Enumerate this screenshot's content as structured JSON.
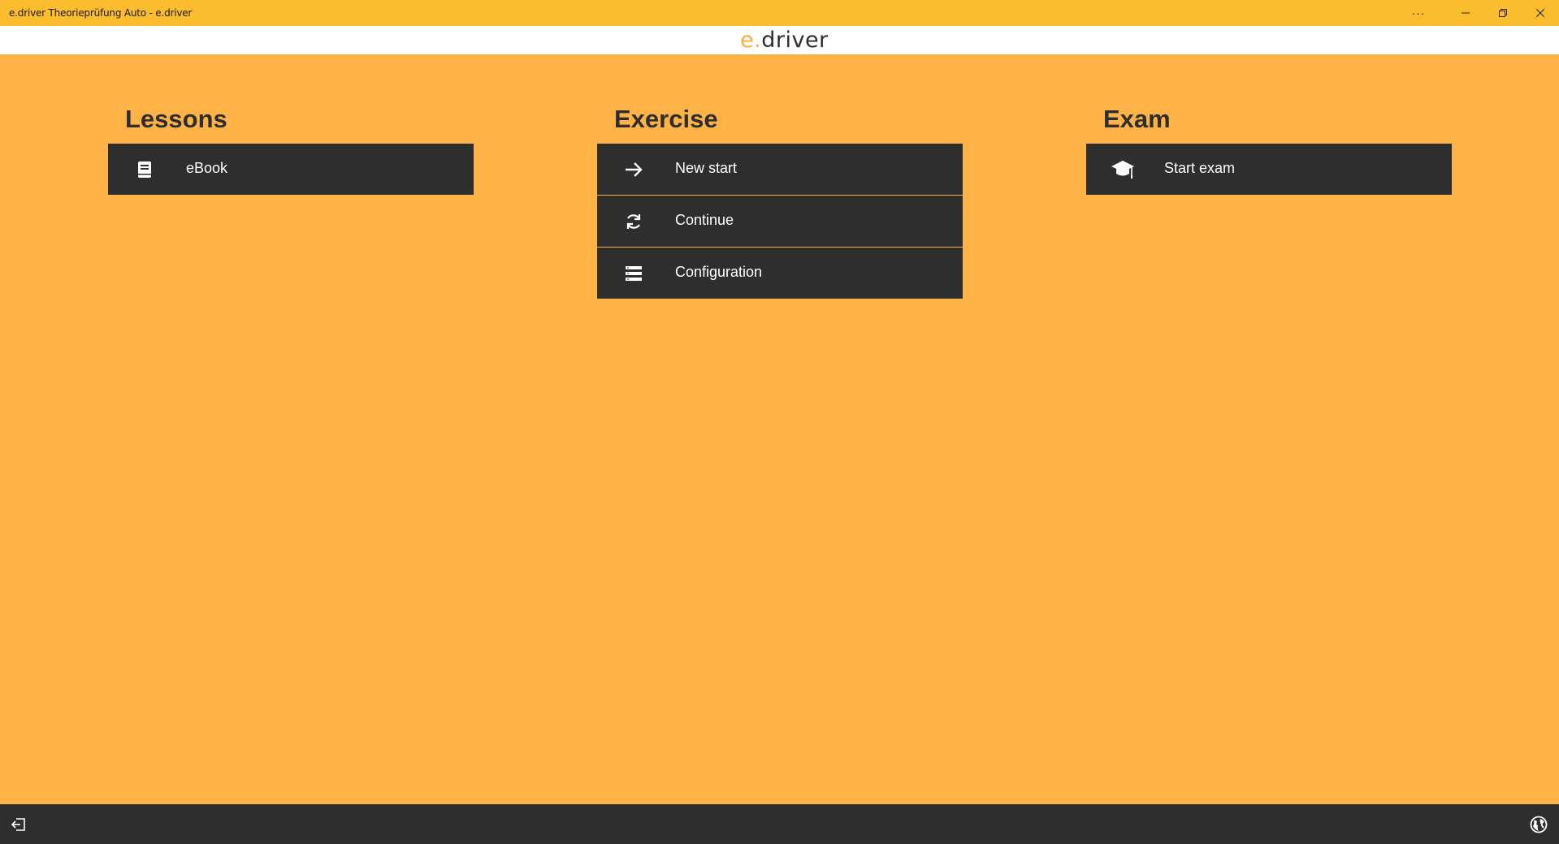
{
  "window": {
    "title": "e.driver Theorieprüfung Auto - e.driver",
    "more_glyph": "···",
    "minimize_glyph": "—",
    "maximize_glyph": "❐",
    "close_glyph": "✕"
  },
  "header": {
    "logo_e": "e",
    "logo_dot": ".",
    "logo_rest": "driver"
  },
  "lessons": {
    "title": "Lessons",
    "items": [
      {
        "label": "eBook",
        "icon": "book-icon"
      }
    ]
  },
  "exercise": {
    "title": "Exercise",
    "items": [
      {
        "label": "New start",
        "icon": "arrow-right-icon"
      },
      {
        "label": "Continue",
        "icon": "refresh-icon"
      },
      {
        "label": "Configuration",
        "icon": "list-icon"
      }
    ]
  },
  "exam": {
    "title": "Exam",
    "items": [
      {
        "label": "Start exam",
        "icon": "graduation-cap-icon"
      }
    ]
  },
  "footer": {
    "left_icon": "logout-icon",
    "right_icon": "globe-icon"
  },
  "colors": {
    "background": "#FFB347",
    "titlebar": "#FBBC2E",
    "tile": "#2E2E2E",
    "accent": "#FBB03B"
  }
}
